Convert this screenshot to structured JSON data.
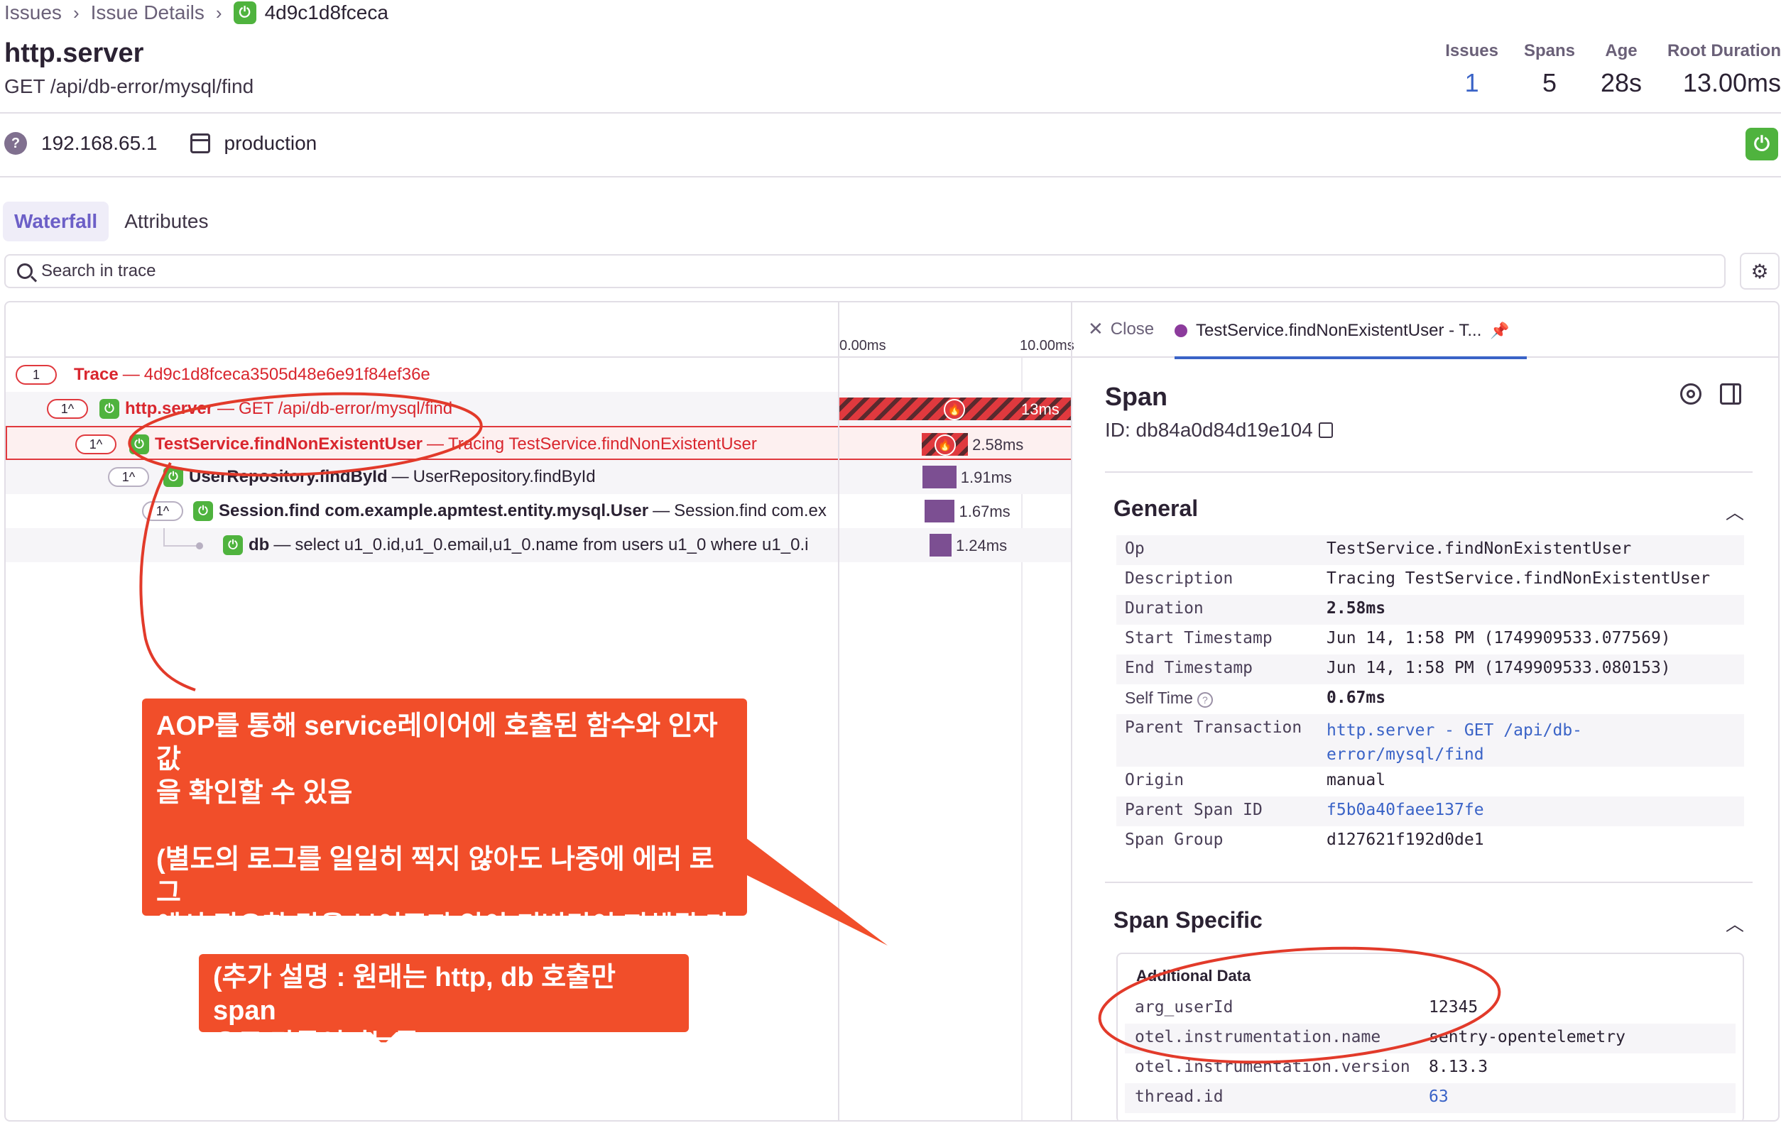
{
  "breadcrumb": {
    "items": [
      "Issues",
      "Issue Details"
    ],
    "current": "4d9c1d8fceca"
  },
  "header": {
    "title": "http.server",
    "subtitle": "GET /api/db-error/mysql/find",
    "stats": [
      {
        "label": "Issues",
        "value": "1"
      },
      {
        "label": "Spans",
        "value": "5"
      },
      {
        "label": "Age",
        "value": "28s"
      },
      {
        "label": "Root Duration",
        "value": "13.00ms"
      }
    ]
  },
  "tags": {
    "ip": "192.168.65.1",
    "environment": "production"
  },
  "tabs": [
    "Waterfall",
    "Attributes"
  ],
  "search": {
    "placeholder": "Search in trace"
  },
  "timeline": {
    "ticks": [
      "0.00ms",
      "10.00ms"
    ]
  },
  "tree": [
    {
      "count": "1",
      "op": "Trace",
      "desc": "4d9c1d8fceca3505d48e6e91f84ef36e"
    },
    {
      "count": "1^",
      "op": "http.server",
      "desc": "GET /api/db-error/mysql/find",
      "duration": "13ms",
      "bar_start_ms": 0.0,
      "bar_end_ms": 13.0
    },
    {
      "count": "1^",
      "op": "TestService.findNonExistentUser",
      "desc": "Tracing TestService.findNonExistentUser",
      "duration": "2.58ms",
      "bar_start_ms": 4.6,
      "bar_end_ms": 7.18
    },
    {
      "count": "1^",
      "op": "UserRepository.findById",
      "desc": "UserRepository.findById",
      "duration": "1.91ms",
      "bar_start_ms": 4.7,
      "bar_end_ms": 6.61
    },
    {
      "count": "1^",
      "op": "Session.find com.example.apmtest.entity.mysql.User",
      "desc": "Session.find com.ex",
      "duration": "1.67ms",
      "bar_start_ms": 4.85,
      "bar_end_ms": 6.52
    },
    {
      "op": "db",
      "desc": "select u1_0.id,u1_0.email,u1_0.name from users u1_0 where u1_0.i",
      "duration": "1.24ms",
      "bar_start_ms": 5.1,
      "bar_end_ms": 6.34
    }
  ],
  "detail": {
    "close_label": "Close",
    "tab_label": "TestService.findNonExistentUser - T...",
    "title": "Span",
    "id_label": "ID: db84a0d84d19e104",
    "general": {
      "title": "General",
      "rows": [
        {
          "key": "Op",
          "value": "TestService.findNonExistentUser"
        },
        {
          "key": "Description",
          "value": "Tracing TestService.findNonExistentUser"
        },
        {
          "key": "Duration",
          "value": "2.58ms"
        },
        {
          "key": "Start Timestamp",
          "value": "Jun 14, 1:58 PM (1749909533.077569)"
        },
        {
          "key": "End Timestamp",
          "value": "Jun 14, 1:58 PM (1749909533.080153)"
        },
        {
          "key": "Self Time",
          "value": "0.67ms"
        },
        {
          "key": "Parent Transaction",
          "value": "http.server - GET /api/db-error/mysql/find"
        },
        {
          "key": "Origin",
          "value": "manual"
        },
        {
          "key": "Parent Span ID",
          "value": "f5b0a40faee137fe"
        },
        {
          "key": "Span Group",
          "value": "d127621f192d0de1"
        }
      ]
    },
    "span_specific": {
      "title": "Span Specific",
      "box_title": "Additional Data",
      "rows": [
        {
          "key": "arg_userId",
          "value": "12345"
        },
        {
          "key": "otel.instrumentation.name",
          "value": "sentry-opentelemetry"
        },
        {
          "key": "otel.instrumentation.version",
          "value": "8.13.3"
        },
        {
          "key": "thread.id",
          "value": "63"
        }
      ]
    }
  },
  "annotations": {
    "callout1": "AOP를 통해 service레이어에 호출된 함수와 인자값\n을 확인할 수 있음\n\n(별도의 로그를 일일히 찍지 않아도 나중에 에러 로그\n에서 필요한 값을 보여주지 않아 디버깅이 지체될 가\n능성 X)",
    "callout2": "(추가 설명 : 원래는 http, db 호출만 span\n으로 만들어지는듯)"
  },
  "colors": {
    "accent": "#6c5fc7",
    "error": "#e0393e",
    "link": "#3a63c7",
    "span_bar": "#7c4f92",
    "annotation": "#f14e2a",
    "sentry_green": "#4fb33e"
  }
}
